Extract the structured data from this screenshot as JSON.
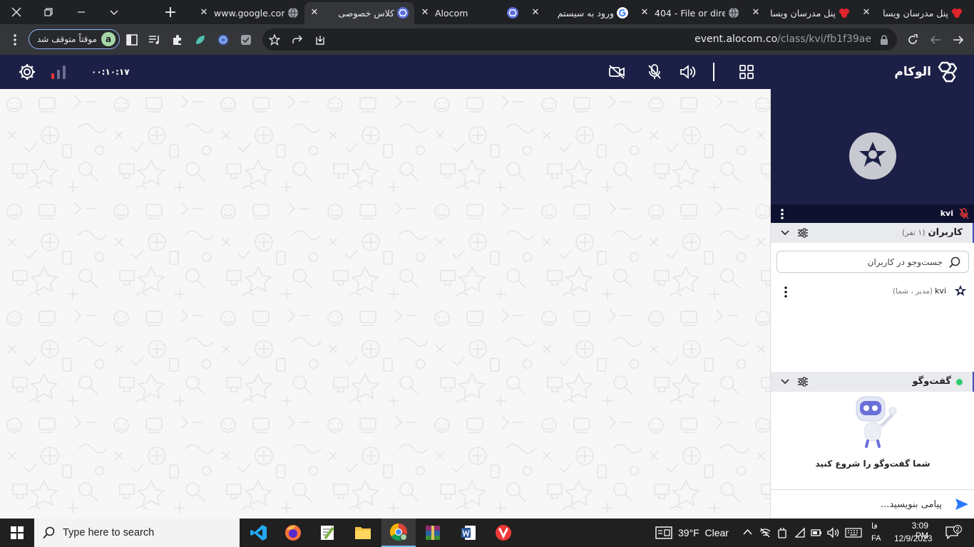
{
  "browser": {
    "tabs": [
      {
        "title": "پنل مدرسان ویسا",
        "favicon": "red-flower-icon",
        "active": false
      },
      {
        "title": "پنل مدرسان ویسا",
        "favicon": "red-flower-icon",
        "active": false
      },
      {
        "title": "404 - File or dire",
        "favicon": "globe-icon",
        "active": false
      },
      {
        "title": "ورود به سیستم",
        "favicon": "google-icon",
        "active": false
      },
      {
        "title": "Alocom",
        "favicon": "alocom-icon",
        "active": false
      },
      {
        "title": "کلاس خصوصی",
        "favicon": "alocom-icon",
        "active": true
      },
      {
        "title": "www.google.com",
        "favicon": "globe-icon",
        "active": false
      }
    ],
    "new_tab_symbol": "+",
    "url_domain": "event.alocom.co",
    "url_path": "/class/kvi/fb1f39ae",
    "profile": {
      "initial": "a",
      "status": "موقتاً متوقف شد"
    },
    "colors": {
      "tabbar": "#202124",
      "toolbar": "#35363a",
      "accent": "#8ab4f8"
    }
  },
  "app": {
    "brand": "الوکام",
    "timer": "۰۰:۱۰:۱۷",
    "colors": {
      "header": "#1d2046",
      "accent": "#3f51b5",
      "online": "#2ecc71",
      "signal_low": "#e53935"
    }
  },
  "video": {
    "name": "kvi"
  },
  "users_panel": {
    "title": "کاربران",
    "count": "(۱ نفر)",
    "search_placeholder": "جست‌وجو در کاربران",
    "users": [
      {
        "name": "kvi",
        "role": "(مدیر ، شما)"
      }
    ]
  },
  "chat_panel": {
    "title": "گفت‌وگو",
    "empty_text": "شما گفت‌وگو را شروع کنید",
    "input_placeholder": "پیامی بنویسید..."
  },
  "taskbar": {
    "search_placeholder": "Type here to search",
    "weather": "39°F  Clear",
    "language": [
      "فا",
      "FA"
    ],
    "time": "3:09 PM",
    "date": "12/9/2023",
    "notifications": "2"
  }
}
